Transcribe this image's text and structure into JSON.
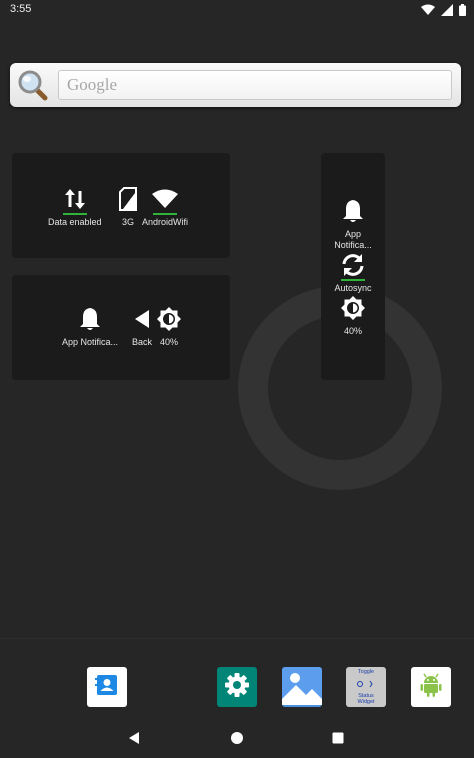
{
  "status_bar": {
    "time": "3:55",
    "icons": [
      "wifi-icon",
      "signal-icon",
      "battery-icon"
    ]
  },
  "search": {
    "placeholder": "Google"
  },
  "widget_top_left": {
    "toggles": [
      {
        "label": "Data enabled",
        "icon": "data-arrows-icon",
        "on": true
      },
      {
        "label": "3G",
        "icon": "sim-card-icon",
        "on": false
      },
      {
        "label": "AndroidWifi",
        "icon": "wifi-icon",
        "on": true
      }
    ]
  },
  "widget_bottom_left": {
    "toggles": [
      {
        "label": "App Notifica...",
        "icon": "bell-icon",
        "on": false
      },
      {
        "label": "Back",
        "icon": "back-triangle-icon",
        "on": false
      },
      {
        "label": "40%",
        "icon": "brightness-icon",
        "on": false
      }
    ]
  },
  "widget_right": {
    "toggles": [
      {
        "label": "App\nNotifica...",
        "icon": "bell-icon",
        "on": false
      },
      {
        "label": "Autosync",
        "icon": "sync-icon",
        "on": true
      },
      {
        "label": "40%",
        "icon": "brightness-icon",
        "on": false
      }
    ]
  },
  "dock": {
    "apps": [
      {
        "name": "contacts-app",
        "icon": "contacts-icon",
        "color": "#ffffff"
      },
      {
        "name": "settings-app",
        "icon": "gear-icon",
        "color": "#008577"
      },
      {
        "name": "gallery-app",
        "icon": "gallery-icon",
        "color": "#4a90e2"
      },
      {
        "name": "toggle-status-widget-app",
        "icon": "toggle-widget-icon",
        "color": "#c9c9c9",
        "lines": [
          "Toggle",
          "Status",
          "Widget"
        ]
      },
      {
        "name": "android-app",
        "icon": "android-icon",
        "color": "#ffffff"
      }
    ]
  },
  "nav_bar": {
    "buttons": [
      "back-icon",
      "home-icon",
      "recents-icon"
    ]
  }
}
